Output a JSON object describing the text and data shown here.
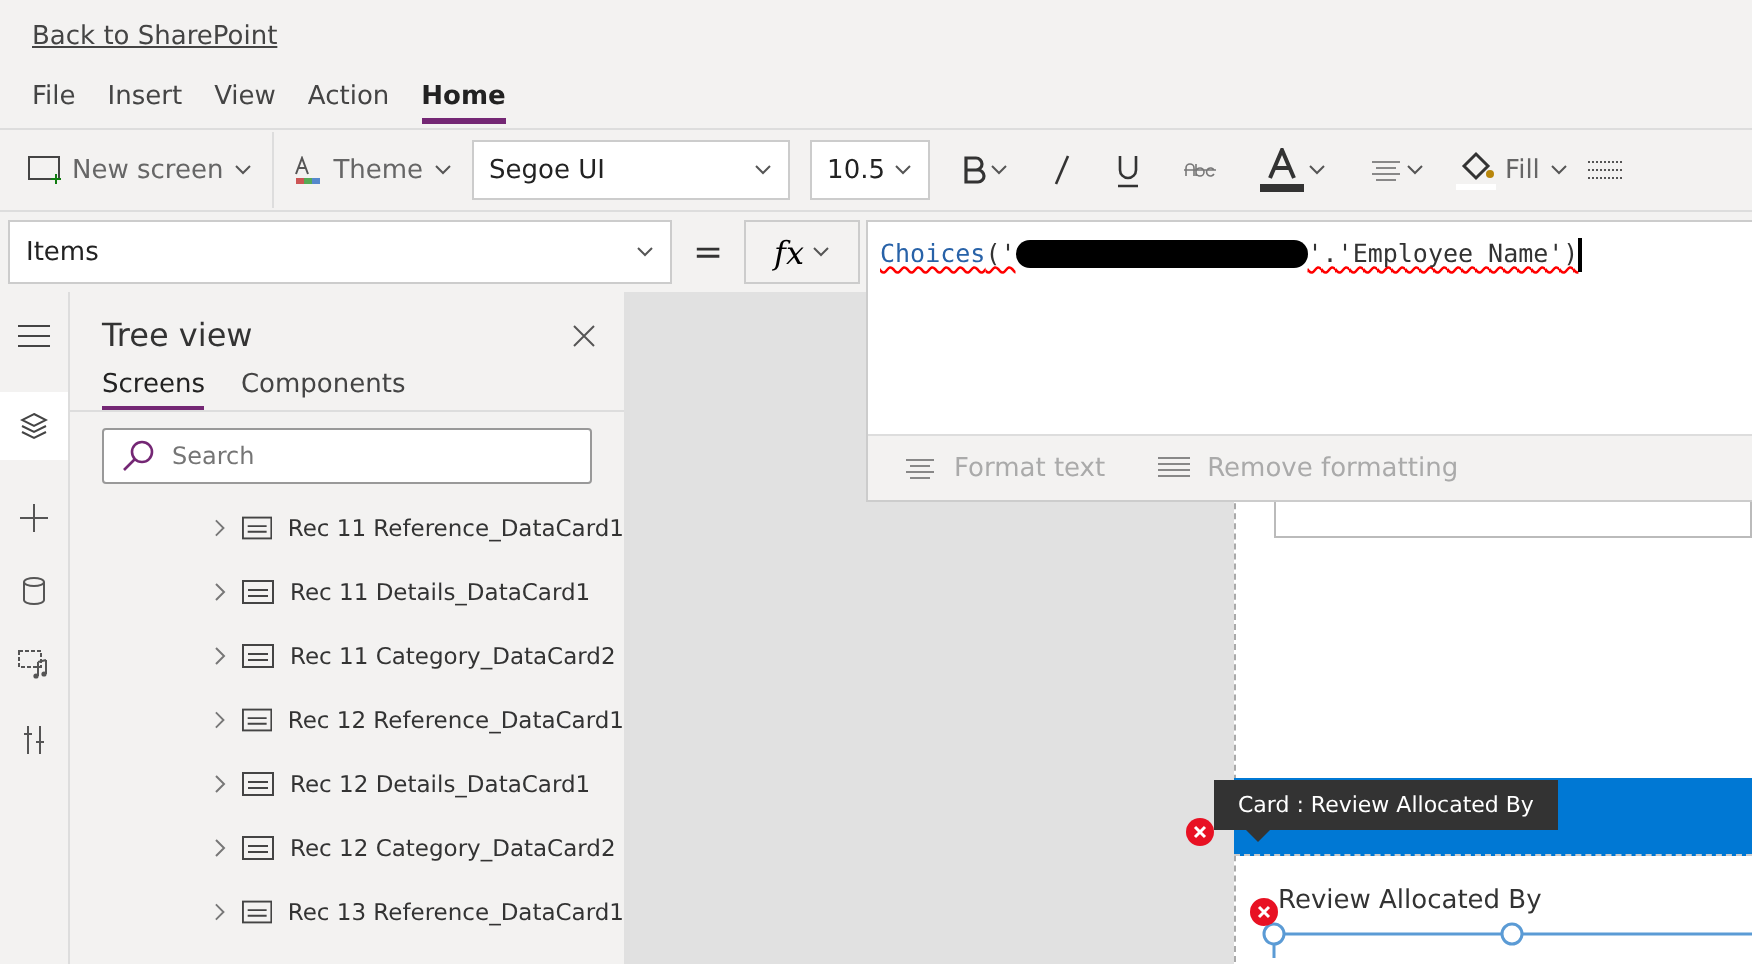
{
  "back_link": "Back to SharePoint",
  "menu_tabs": [
    {
      "label": "File",
      "selected": false
    },
    {
      "label": "Insert",
      "selected": false
    },
    {
      "label": "View",
      "selected": false
    },
    {
      "label": "Action",
      "selected": false
    },
    {
      "label": "Home",
      "selected": true
    }
  ],
  "toolbar": {
    "new_screen": "New screen",
    "theme": "Theme",
    "font": "Segoe UI",
    "font_size": "10.5",
    "fill": "Fill"
  },
  "formula_bar": {
    "property": "Items",
    "equals": "=",
    "fx": "fx",
    "function": "Choices",
    "args_before": "('",
    "args_after": "'.'Employee Name')",
    "has_error": true,
    "format_text": "Format text",
    "remove_formatting": "Remove formatting"
  },
  "tree_view": {
    "title": "Tree view",
    "tabs": [
      {
        "label": "Screens",
        "selected": true
      },
      {
        "label": "Components",
        "selected": false
      }
    ],
    "search": {
      "placeholder": "Search"
    },
    "items": [
      {
        "label": "Rec 11 Reference_DataCard1"
      },
      {
        "label": "Rec 11 Details_DataCard1"
      },
      {
        "label": "Rec 11 Category_DataCard2"
      },
      {
        "label": "Rec 12 Reference_DataCard1"
      },
      {
        "label": "Rec 12 Details_DataCard1"
      },
      {
        "label": "Rec 12 Category_DataCard2"
      },
      {
        "label": "Rec 13 Reference_DataCard1"
      }
    ]
  },
  "canvas": {
    "tooltip": "Card : Review Allocated By",
    "card_label": "Review Allocated By"
  }
}
